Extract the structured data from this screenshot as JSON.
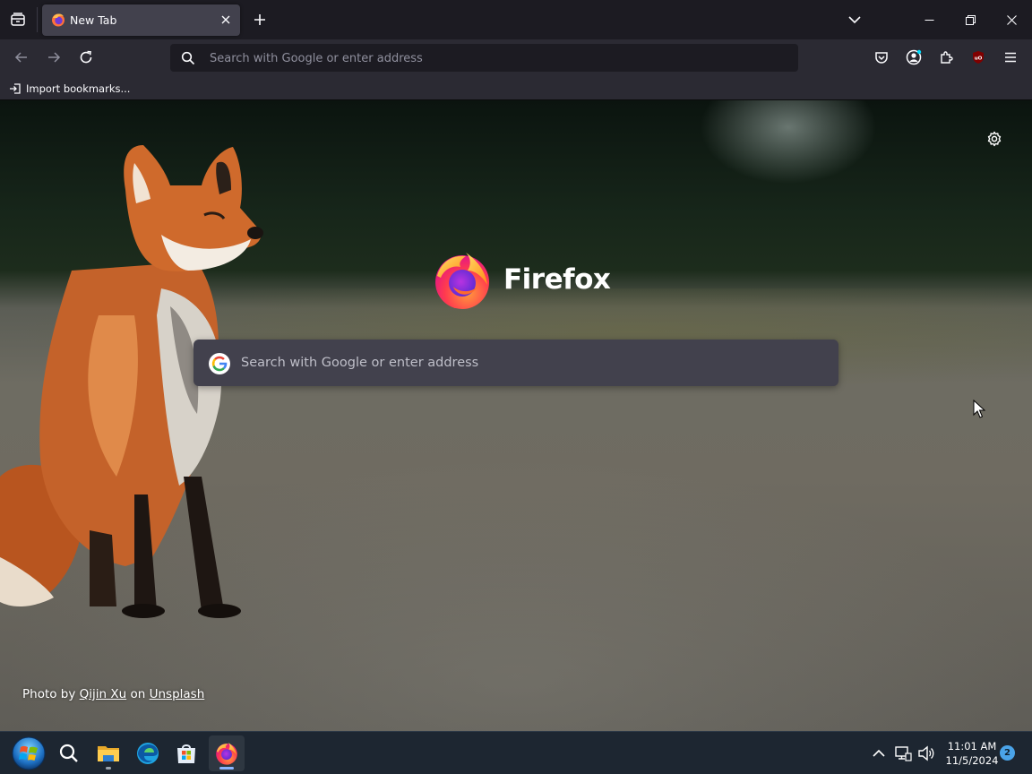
{
  "tabs": [
    {
      "title": "New Tab",
      "icon": "firefox-logo-icon",
      "active": true
    }
  ],
  "toolbar": {
    "urlbar_placeholder": "Search with Google or enter address"
  },
  "bookmarks": {
    "import_label": "Import bookmarks..."
  },
  "newtab": {
    "logo_text": "Firefox",
    "search_placeholder": "Search with Google or enter address",
    "credit": {
      "prefix": "Photo by ",
      "author": "Qijin Xu",
      "middle": " on ",
      "site": "Unsplash"
    }
  },
  "taskbar": {
    "apps": [
      "start-orb-icon",
      "search-icon",
      "file-explorer-icon",
      "edge-icon",
      "microsoft-store-icon",
      "firefox-icon"
    ],
    "clock_time": "11:01 AM",
    "clock_date": "11/5/2024",
    "notification_count": "2"
  },
  "colors": {
    "tabbar_bg": "#1c1b22",
    "toolbar_bg": "#2b2a33",
    "selected_tab": "#42414d",
    "taskbar_bg": "#1d2631"
  }
}
